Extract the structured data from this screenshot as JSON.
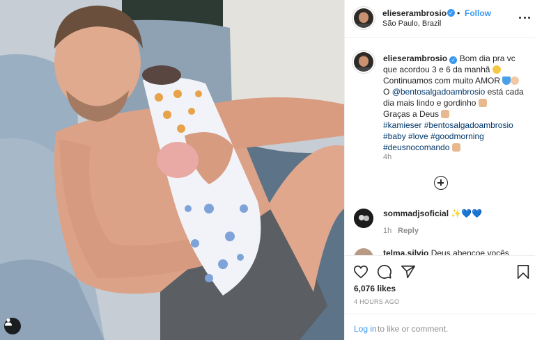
{
  "post": {
    "username": "elieserambrosio",
    "location": "São Paulo, Brazil",
    "follow_label": "Follow",
    "dot": "•",
    "verified_mark": "✓"
  },
  "caption": {
    "username": "elieserambrosio",
    "line1": "Bom dia pra vc",
    "line2": "que acordou 3 e 6 da manhã",
    "line3": "Continuamos com muito AMOR",
    "line4_prefix": "O",
    "mention": "@bentosalgadoambrosio",
    "line4_suffix": "está cada",
    "line5": "dia mais lindo e gordinho",
    "line6": "Graças a Deus",
    "hashtags_line1": [
      "#kamieser",
      "#bentosalgadoambrosio"
    ],
    "hashtags_line2": [
      "#baby",
      "#love",
      "#goodmorning"
    ],
    "hashtags_line3": [
      "#deusnocomando"
    ],
    "time": "4h"
  },
  "comments": [
    {
      "username": "sommadjsoficial",
      "text": "✨💙💙",
      "time": "1h",
      "reply_label": "Reply"
    },
    {
      "username": "telma.silvio",
      "text": "Deus abençoe vocês"
    }
  ],
  "actions": {
    "likes": "6,076 likes",
    "posted_ago": "4 HOURS AGO",
    "login_link": "Log in",
    "login_rest": "to like or comment."
  },
  "icons": {
    "like": "heart-icon",
    "comment": "comment-icon",
    "share": "paper-plane-icon",
    "save": "bookmark-icon",
    "more": "more-options-icon",
    "load_more": "plus-circle-icon",
    "tagged_user": "user-icon"
  },
  "colors": {
    "link_blue": "#3897f0",
    "hashtag_navy": "#00376b",
    "muted_gray": "#8e8e8e",
    "border": "#efefef"
  }
}
